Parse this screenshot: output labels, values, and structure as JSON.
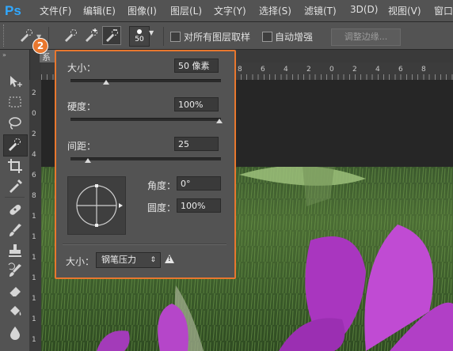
{
  "app": {
    "logo": "Ps"
  },
  "menu": [
    "文件(F)",
    "编辑(E)",
    "图像(I)",
    "图层(L)",
    "文字(Y)",
    "选择(S)",
    "滤镜(T)",
    "3D(D)",
    "视图(V)",
    "窗口"
  ],
  "options": {
    "brush_size": "50",
    "sample_all_layers": "对所有图层取样",
    "auto_enhance": "自动增强",
    "refine_edge": "调整边缘..."
  },
  "popup": {
    "size_label": "大小：",
    "size_value": "50 像素",
    "size_fraction": 0.2,
    "hardness_label": "硬度：",
    "hardness_value": "100%",
    "hardness_fraction": 1.0,
    "spacing_label": "间距：",
    "spacing_value": "25",
    "spacing_fraction": 0.1,
    "angle_label": "角度：",
    "angle_value": "0°",
    "roundness_label": "圆度：",
    "roundness_value": "100%",
    "pressure_label": "大小：",
    "pressure_value": "钢笔压力",
    "warning": "!"
  },
  "callout": "2",
  "doc_tab": "系",
  "ruler_top_labels": [
    "8",
    "6",
    "4",
    "2",
    "0",
    "2",
    "4",
    "6",
    "8"
  ],
  "ruler_left_labels": [
    "2",
    "0",
    "2",
    "4",
    "6",
    "8",
    "1",
    "1",
    "1",
    "1",
    "1",
    "1",
    "1",
    "1"
  ],
  "colors": {
    "accent": "#e8772e",
    "ps_blue": "#31a8ff",
    "panel": "#535353"
  },
  "icons": {
    "toolbox": [
      "move-tool-icon",
      "marquee-tool-icon",
      "lasso-tool-icon",
      "quick-selection-tool-icon",
      "crop-tool-icon",
      "eyedropper-tool-icon",
      "healing-brush-tool-icon",
      "brush-tool-icon",
      "clone-stamp-tool-icon",
      "history-brush-tool-icon",
      "eraser-tool-icon",
      "paint-bucket-tool-icon",
      "blur-tool-icon"
    ]
  }
}
